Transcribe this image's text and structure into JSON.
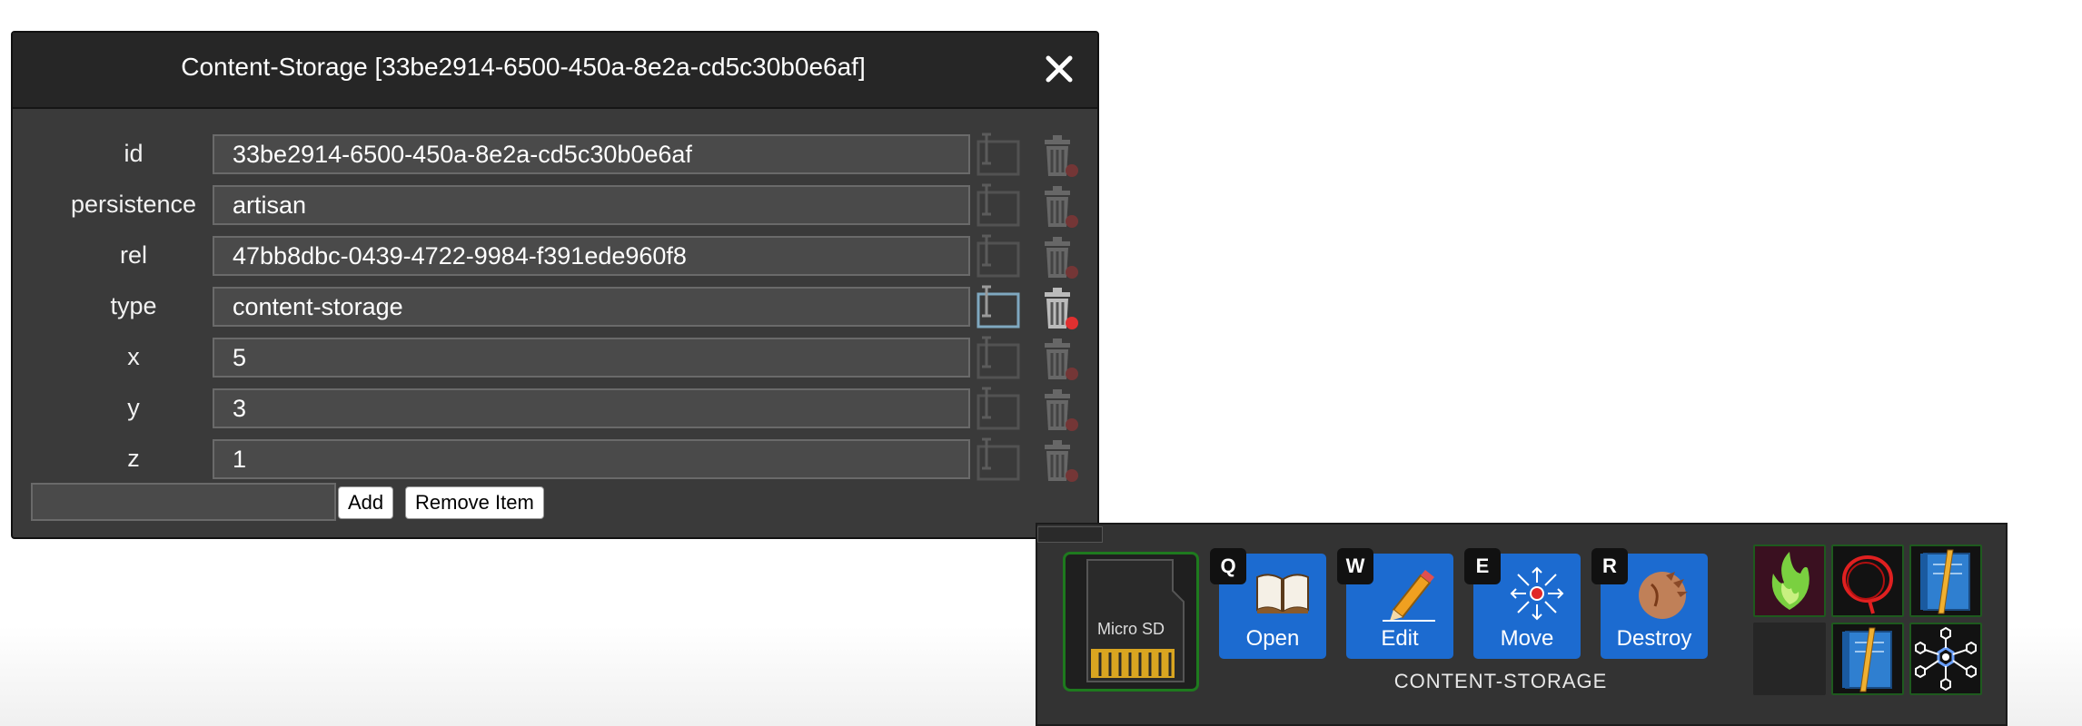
{
  "dialog": {
    "title": "Content-Storage  [33be2914-6500-450a-8e2a-cd5c30b0e6af]",
    "close_label": "close",
    "properties": [
      {
        "key": "id",
        "value": "33be2914-6500-450a-8e2a-cd5c30b0e6af",
        "active": false
      },
      {
        "key": "persistence",
        "value": "artisan",
        "active": false
      },
      {
        "key": "rel",
        "value": "47bb8dbc-0439-4722-9984-f391ede960f8",
        "active": false
      },
      {
        "key": "type",
        "value": "content-storage",
        "active": true
      },
      {
        "key": "x",
        "value": "5",
        "active": false
      },
      {
        "key": "y",
        "value": "3",
        "active": false
      },
      {
        "key": "z",
        "value": "1",
        "active": false
      }
    ],
    "new_key_placeholder": "",
    "add_label": "Add",
    "remove_label": "Remove Item"
  },
  "panel": {
    "selected_item_label": "Micro SD",
    "name": "CONTENT-STORAGE",
    "actions": [
      {
        "key": "Q",
        "label": "Open",
        "icon": "book-icon"
      },
      {
        "key": "W",
        "label": "Edit",
        "icon": "pencil-icon"
      },
      {
        "key": "E",
        "label": "Move",
        "icon": "move-icon"
      },
      {
        "key": "R",
        "label": "Destroy",
        "icon": "destroy-icon"
      }
    ],
    "inventory": [
      {
        "icon": "green-flame-icon"
      },
      {
        "icon": "red-cable-icon"
      },
      {
        "icon": "blue-notebook-icon"
      },
      {
        "icon": "empty-slot"
      },
      {
        "icon": "blue-notebook-icon"
      },
      {
        "icon": "network-hex-icon"
      }
    ],
    "colors": {
      "action_blue": "#1c6bd0",
      "slot_border": "#1e5a1e",
      "panel_bg": "#333333"
    }
  }
}
